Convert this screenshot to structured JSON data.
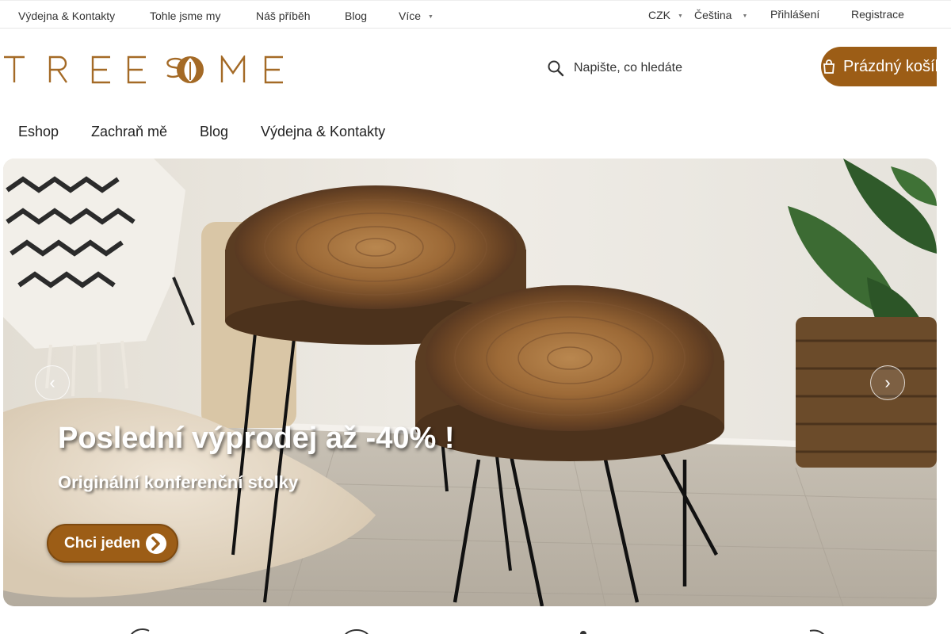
{
  "topbar": {
    "links": [
      "Výdejna & Kontakty",
      "Tohle jsme my",
      "Náš příběh",
      "Blog",
      "Více"
    ],
    "currency": "CZK",
    "language": "Čeština",
    "login": "Přihlášení",
    "register": "Registrace"
  },
  "header": {
    "logo_text": "TREESOME",
    "search_placeholder": "Napište, co hledáte",
    "cart_label": "Prázdný košík"
  },
  "nav": {
    "items": [
      "Eshop",
      "Zachraň mě",
      "Blog",
      "Výdejna & Kontakty"
    ]
  },
  "hero": {
    "headline": "Poslední výprodej až -40% !",
    "subline": "Originální konferenční stolky",
    "cta_label": "Chci jeden"
  },
  "colors": {
    "brand": "#9c5d16",
    "logo": "#a46a26",
    "text": "#222222"
  },
  "icons": [
    "search-icon",
    "cart-icon",
    "chevron-left-icon",
    "chevron-right-icon",
    "chevron-circle-right-icon",
    "chevron-down-icon"
  ]
}
